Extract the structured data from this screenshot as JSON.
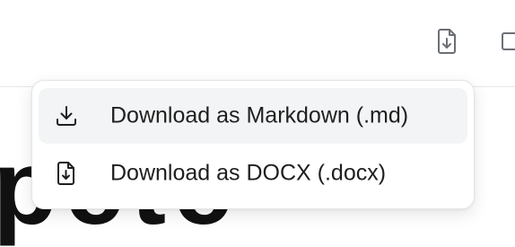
{
  "toolbar": {
    "buttons": [
      {
        "icon": "file-download-icon"
      },
      {
        "icon": "panel-icon"
      }
    ]
  },
  "page": {
    "heading_partial": "pete"
  },
  "menu": {
    "items": [
      {
        "label": "Download as Markdown (.md)",
        "icon": "download-icon",
        "highlighted": true
      },
      {
        "label": "Download as DOCX (.docx)",
        "icon": "file-download-icon",
        "highlighted": false
      }
    ]
  }
}
